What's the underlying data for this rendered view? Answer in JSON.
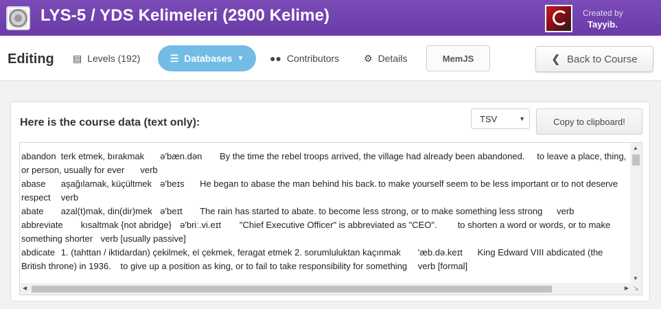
{
  "header": {
    "course_title": "LYS-5 / YDS Kelimeleri (2900 Kelime)",
    "created_by_label": "Created by",
    "creator": "Tayyib.",
    "brand_color": "#6f40ad"
  },
  "navbar": {
    "editing_label": "Editing",
    "levels_label": "Levels (192)",
    "databases_label": "Databases",
    "contributors_label": "Contributors",
    "details_label": "Details",
    "memjs_label": "MemJS",
    "back_label": "Back to Course",
    "active_tab_color": "#72bce5"
  },
  "panel": {
    "title": "Here is the course data (text only):",
    "format_selected": "TSV",
    "copy_label": "Copy to clipboard!",
    "content": "abandon\tterk etmek, bırakmak\tə'bæn.dən\tBy the time the rebel troops arrived, the village had already been abandoned.\tto leave a place, thing, or person, usually for ever\tverb\nabase\taşağılamak, küçültmek\tə'beɪs\tHe began to abase the man behind his back.\tto make yourself seem to be less important or to not deserve respect\tverb\nabate\tazal(t)mak, din(dir)mek\tə'beɪt\tThe rain has started to abate.\tto become less strong, or to make something less strong\tverb\nabbreviate\tkısaltmak {not abridge}\tə'briː.vi.eɪt\t\"Chief Executive Officer\" is abbreviated as \"CEO\".\tto shorten a word or words, or to make something shorter\tverb [usually passive]\nabdicate\t1. (tahttan / iktidardan) çekilmek, el çekmek, feragat etmek 2. sorumluluktan kaçınmak\t'æb.də.keɪt\tKing Edward VIII abdicated (the British throne) in 1936.\tto give up a position as king, or to fail to take responsibility for something\tverb [formal]"
  },
  "icons": {
    "levels": "list-icon",
    "databases": "menu-icon",
    "contributors": "users-icon",
    "details": "gear-icon",
    "back": "chevron-left-icon"
  }
}
